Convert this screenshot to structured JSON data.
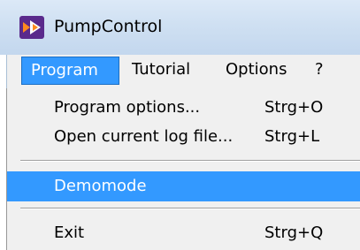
{
  "window": {
    "title": "PumpControl",
    "icon": "pumpcontrol-app-icon"
  },
  "menubar": {
    "items": [
      {
        "label": "Program",
        "active": true
      },
      {
        "label": "Tutorial",
        "active": false
      },
      {
        "label": "Options",
        "active": false
      },
      {
        "label": "?",
        "active": false
      }
    ]
  },
  "program_menu": {
    "items": [
      {
        "label": "Program options...",
        "shortcut": "Strg+O"
      },
      {
        "label": "Open current log file...",
        "shortcut": "Strg+L"
      },
      {
        "label": "Demomode",
        "shortcut": "",
        "highlighted": true
      },
      {
        "label": "Exit",
        "shortcut": "Strg+Q"
      }
    ]
  },
  "colors": {
    "highlight": "#3399ff",
    "menu_background": "#f0f0f0",
    "titlebar": "#cfe0f2"
  }
}
